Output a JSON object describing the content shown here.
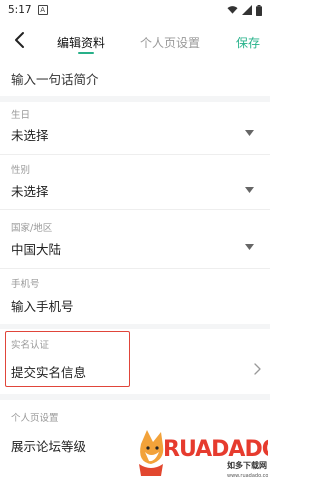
{
  "status_bar": {
    "time": "5:17",
    "warning_icon": "alert-box-icon",
    "wifi_icon": "wifi-icon",
    "signal_icon": "signal-icon",
    "battery_icon": "battery-icon"
  },
  "header": {
    "back_icon": "chevron-left-icon",
    "tabs": [
      {
        "label": "编辑资料",
        "active": true
      },
      {
        "label": "个人页设置",
        "active": false
      }
    ],
    "save_label": "保存",
    "accent_color": "#26b28a"
  },
  "bio": {
    "placeholder": "输入一句话简介"
  },
  "fields": {
    "birthday": {
      "label": "生日",
      "value": "未选择"
    },
    "gender": {
      "label": "性别",
      "value": "未选择"
    },
    "region": {
      "label": "国家/地区",
      "value": "中国大陆"
    },
    "phone": {
      "label": "手机号",
      "value": "输入手机号"
    }
  },
  "verification": {
    "section_label": "实名认证",
    "item_label": "提交实名信息",
    "highlight_color": "#e0453a"
  },
  "profile_settings": {
    "section_label": "个人页设置",
    "item_label": "展示论坛等级"
  },
  "watermark": {
    "brand": "RUADADO",
    "tagline": "如多下载网",
    "url": "www.ruadado.com"
  }
}
